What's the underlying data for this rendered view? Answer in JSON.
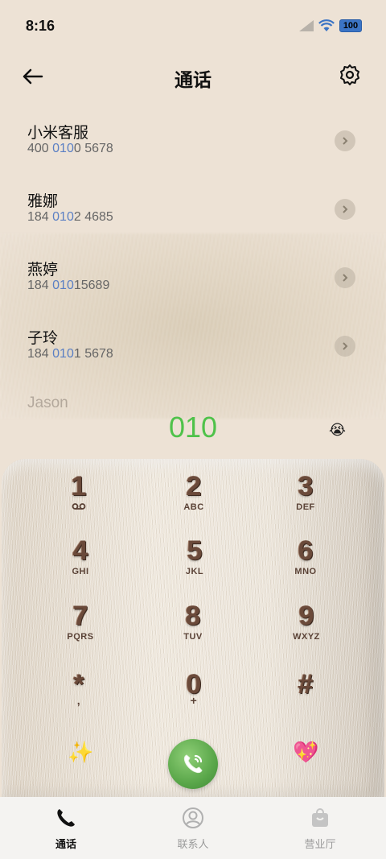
{
  "status": {
    "time": "8:16",
    "battery": "100"
  },
  "header": {
    "title": "通话"
  },
  "contacts": [
    {
      "name": "小米客服",
      "num_pre": "400 ",
      "num_hl": "010",
      "num_post": "0 5678"
    },
    {
      "name": "雅娜",
      "num_pre": "184 ",
      "num_hl": "010",
      "num_post": "2 4685"
    },
    {
      "name": "燕婷",
      "num_pre": "184 ",
      "num_hl": "010",
      "num_post": "15689"
    },
    {
      "name": "子玲",
      "num_pre": "184 ",
      "num_hl": "010",
      "num_post": "1 5678"
    }
  ],
  "faded_contact": "Jason",
  "dial": {
    "input": "010"
  },
  "keypad": [
    {
      "digit": "1",
      "letters": ""
    },
    {
      "digit": "2",
      "letters": "ABC"
    },
    {
      "digit": "3",
      "letters": "DEF"
    },
    {
      "digit": "4",
      "letters": "GHI"
    },
    {
      "digit": "5",
      "letters": "JKL"
    },
    {
      "digit": "6",
      "letters": "MNO"
    },
    {
      "digit": "7",
      "letters": "PQRS"
    },
    {
      "digit": "8",
      "letters": "TUV"
    },
    {
      "digit": "9",
      "letters": "WXYZ"
    },
    {
      "digit": "*",
      "letters": ","
    },
    {
      "digit": "0",
      "letters": "+"
    },
    {
      "digit": "#",
      "letters": ""
    }
  ],
  "nav": [
    {
      "label": "通话",
      "icon": "phone-icon",
      "active": true
    },
    {
      "label": "联系人",
      "icon": "person-icon",
      "active": false
    },
    {
      "label": "营业厅",
      "icon": "bag-icon",
      "active": false
    }
  ],
  "colors": {
    "dial_green": "#4fc24a",
    "highlight_blue": "#5a7fc4",
    "background": "#ede2d5"
  }
}
